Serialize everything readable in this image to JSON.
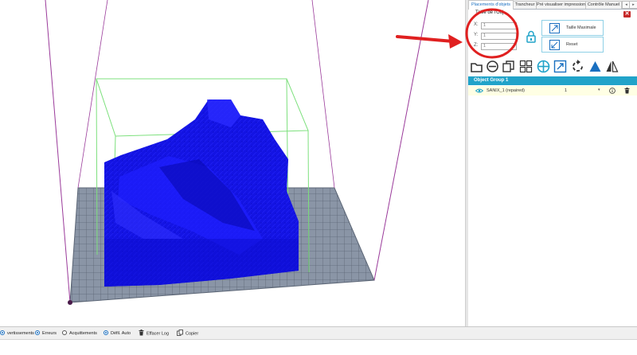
{
  "tabs": [
    {
      "label": "Placements d'objets",
      "active": true
    },
    {
      "label": "Trancheur",
      "active": false
    },
    {
      "label": "Pré visualiser impression",
      "active": false
    },
    {
      "label": "Contrôle Manuel",
      "active": false
    }
  ],
  "tab_scroll": {
    "left": "◂",
    "right": "▸"
  },
  "object_size": {
    "title": "Taille de l'Obj",
    "x_label": "X:",
    "x_value": "1",
    "y_label": "Y:",
    "y_value": "1",
    "z_label": "Z:",
    "z_value": "1"
  },
  "buttons": {
    "max_size_label": "Taille Maximale",
    "reset_label": "Reset",
    "close_label": "✕"
  },
  "toolbar_icons": [
    "add-object-icon",
    "center-icon",
    "copy-icon",
    "autoposition-icon",
    "center-object-icon",
    "scale-icon",
    "rotate-icon",
    "mirror-icon",
    "cut-icon"
  ],
  "object_list": {
    "group_name": "Object Group 1",
    "items": [
      {
        "name": "SANIX_1 (repaired)",
        "quantity": "1"
      }
    ]
  },
  "log_bar": {
    "items": [
      {
        "label": "vertissements",
        "checked": true
      },
      {
        "label": "Erreurs",
        "checked": true
      },
      {
        "label": "Acquittements",
        "checked": false
      },
      {
        "label": "Défil. Auto",
        "checked": true
      },
      {
        "label": "Effacer Log"
      },
      {
        "label": "Copier"
      }
    ]
  },
  "colors": {
    "accent": "#21a3c9",
    "model": "#1010e0",
    "annotation": "#e02020",
    "bounding_box": "#7de07d",
    "build_volume": "#9a3a9a"
  }
}
